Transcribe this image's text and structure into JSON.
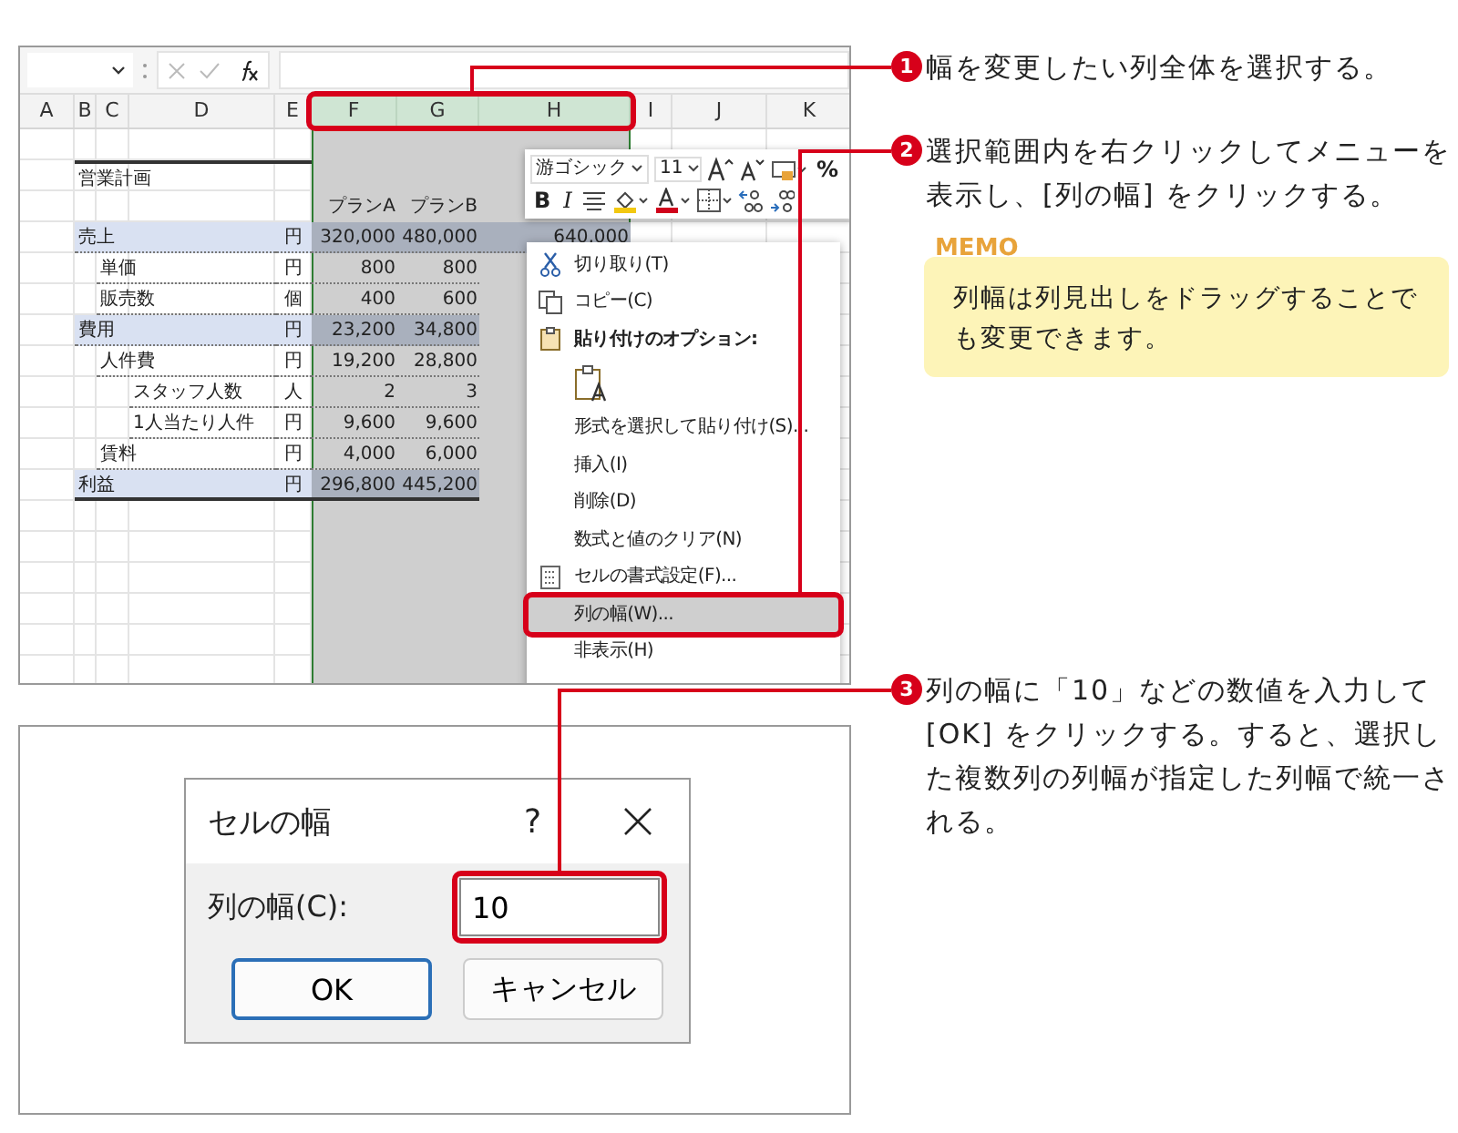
{
  "sheet": {
    "columns": [
      {
        "label": "A",
        "selected": false
      },
      {
        "label": "B",
        "selected": false
      },
      {
        "label": "C",
        "selected": false
      },
      {
        "label": "D",
        "selected": false
      },
      {
        "label": "E",
        "selected": false
      },
      {
        "label": "F",
        "selected": true
      },
      {
        "label": "G",
        "selected": true
      },
      {
        "label": "H",
        "selected": true
      },
      {
        "label": "I",
        "selected": false
      },
      {
        "label": "J",
        "selected": false
      },
      {
        "label": "K",
        "selected": false
      }
    ],
    "title": "営業計画",
    "headers": [
      "プランA",
      "プランB"
    ],
    "lines": [
      {
        "kind": "section",
        "label": "売上",
        "unit": "円",
        "values": [
          "320,000",
          "480,000",
          "640,000"
        ],
        "children": [
          {
            "label": "単価",
            "unit": "円",
            "values": [
              "800",
              "800"
            ]
          },
          {
            "label": "販売数",
            "unit": "個",
            "values": [
              "400",
              "600"
            ]
          }
        ]
      },
      {
        "kind": "section",
        "label": "費用",
        "unit": "円",
        "values": [
          "23,200",
          "34,800"
        ],
        "children": [
          {
            "label": "人件費",
            "unit": "円",
            "values": [
              "19,200",
              "28,800"
            ],
            "children": [
              {
                "label": "スタッフ人数",
                "unit": "人",
                "values": [
                  "2",
                  "3"
                ]
              },
              {
                "label": "1人当たり人件",
                "unit": "円",
                "values": [
                  "9,600",
                  "9,600"
                ]
              }
            ]
          },
          {
            "label": "賃料",
            "unit": "円",
            "values": [
              "4,000",
              "6,000"
            ]
          }
        ]
      },
      {
        "kind": "total",
        "label": "利益",
        "unit": "円",
        "values": [
          "296,800",
          "445,200"
        ]
      }
    ]
  },
  "mini_toolbar": {
    "font": "游ゴシック",
    "size": "11",
    "percent": "%",
    "bold": "B",
    "italic": "I"
  },
  "context_menu": [
    {
      "kind": "item",
      "label": "切り取り(T)",
      "selected": false
    },
    {
      "kind": "item",
      "label": "コピー(C)",
      "selected": false
    },
    {
      "kind": "header",
      "label": "貼り付けのオプション:",
      "selected": false
    },
    {
      "kind": "paste-options",
      "selected": false
    },
    {
      "kind": "item",
      "label": "形式を選択して貼り付け(S)...",
      "selected": false
    },
    {
      "kind": "item",
      "label": "挿入(I)",
      "selected": false
    },
    {
      "kind": "item",
      "label": "削除(D)",
      "selected": false
    },
    {
      "kind": "item",
      "label": "数式と値のクリア(N)",
      "selected": false
    },
    {
      "kind": "item",
      "label": "セルの書式設定(F)...",
      "selected": false
    },
    {
      "kind": "item",
      "label": "列の幅(W)...",
      "selected": true
    },
    {
      "kind": "item",
      "label": "非表示(H)",
      "selected": false
    }
  ],
  "dialog": {
    "title": "セルの幅",
    "help": "?",
    "field_label": "列の幅(C):",
    "field_value": "10",
    "buttons": [
      {
        "label": "OK",
        "default": true
      },
      {
        "label": "キャンセル",
        "default": false
      }
    ]
  },
  "steps": [
    {
      "number": "1",
      "text": "幅を変更したい列全体を選択する。"
    },
    {
      "number": "2",
      "text": "選択範囲内を右クリックしてメニューを表示し、[列の幅] をクリックする。"
    },
    {
      "number": "3",
      "text": "列の幅に「10」などの数値を入力して [OK] をクリックする。すると、選択した複数列の列幅が指定した列幅で統一される。"
    }
  ],
  "memo": {
    "label": "MEMO",
    "text": "列幅は列見出しをドラッグすることでも変更できます。"
  }
}
